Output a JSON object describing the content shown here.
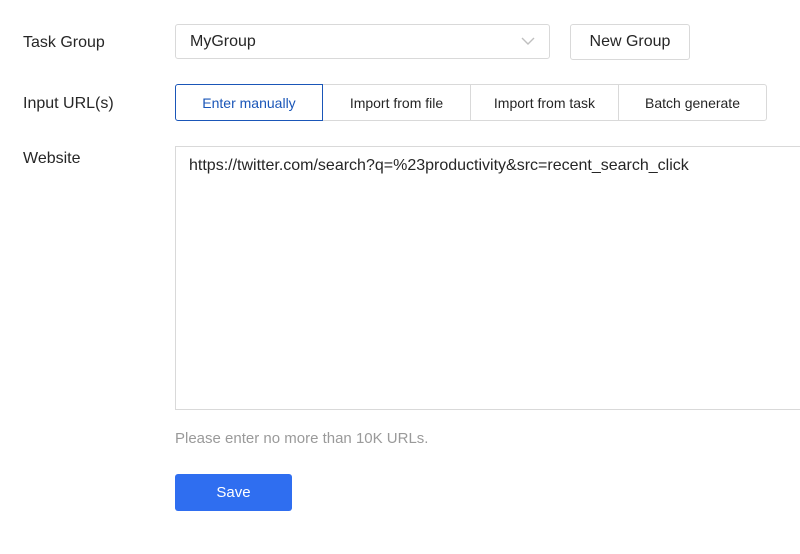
{
  "form": {
    "task_group": {
      "label": "Task Group",
      "selected": "MyGroup",
      "new_group_label": "New Group"
    },
    "input_urls": {
      "label": "Input URL(s)",
      "tabs": [
        {
          "label": "Enter manually",
          "active": true
        },
        {
          "label": "Import from file",
          "active": false
        },
        {
          "label": "Import from task",
          "active": false
        },
        {
          "label": "Batch generate",
          "active": false
        }
      ]
    },
    "website": {
      "label": "Website",
      "value": "https://twitter.com/search?q=%23productivity&src=recent_search_click"
    },
    "hint": "Please enter no more than 10K URLs.",
    "save_label": "Save"
  },
  "colors": {
    "accent": "#2f6ef0",
    "active_tab": "#1a56b8",
    "border": "#d9d9d9",
    "hint": "#9a9a9a"
  },
  "icons": {
    "select_chevron": "chevron-down-icon"
  }
}
